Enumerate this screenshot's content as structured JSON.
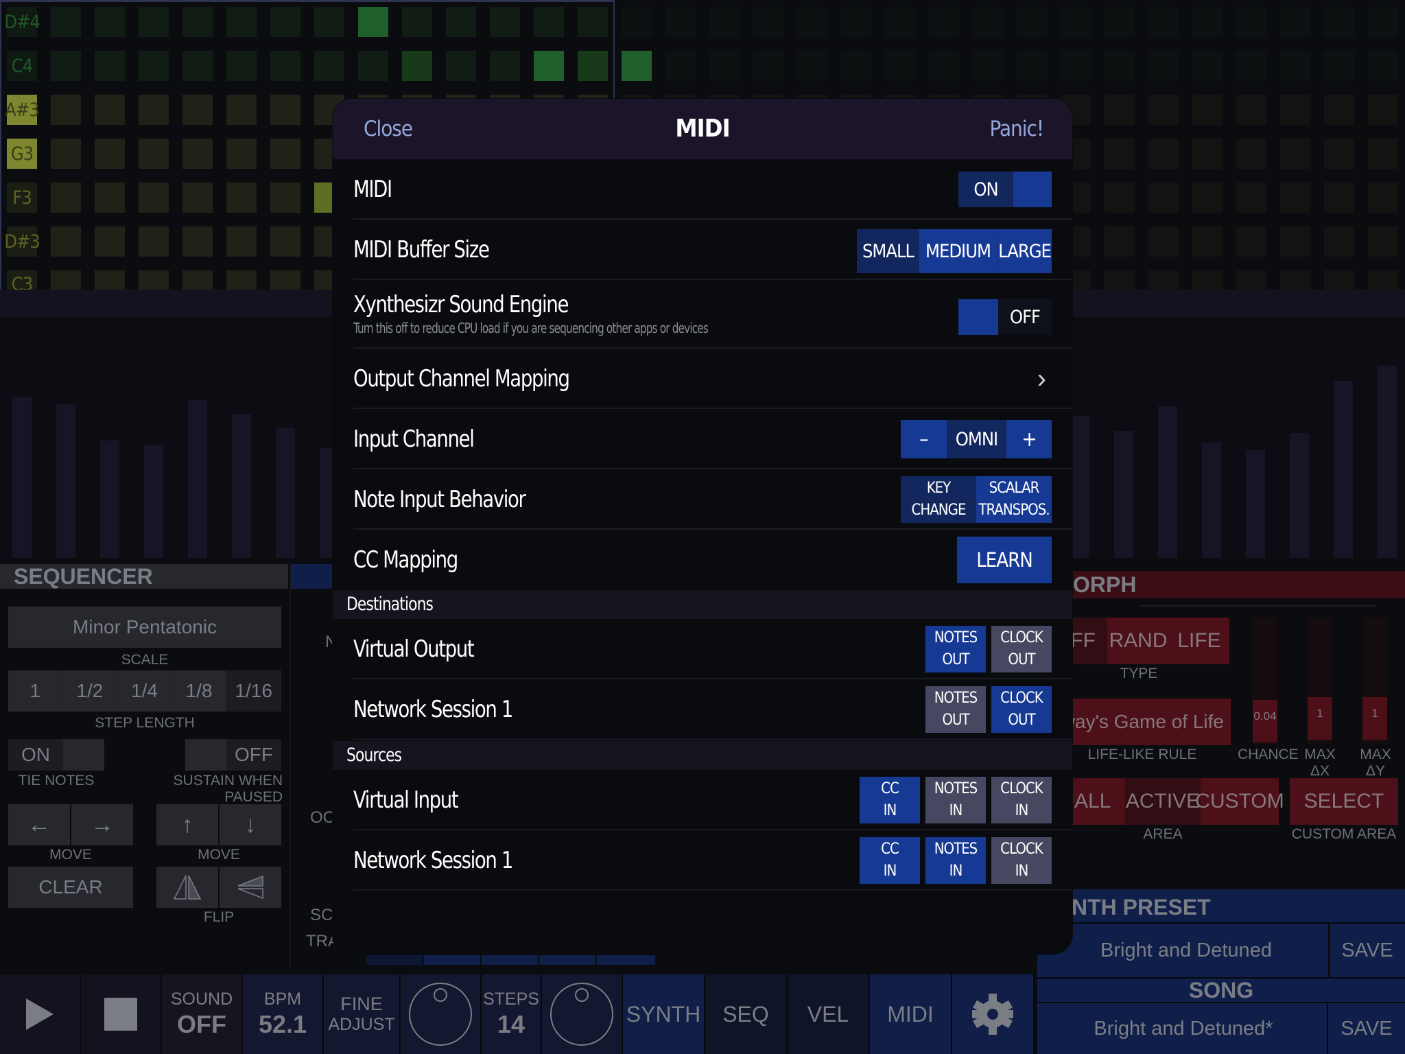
{
  "modal": {
    "title": "MIDI",
    "close_label": "Close",
    "panic_label": "Panic!",
    "rows": {
      "midi": {
        "label": "MIDI",
        "toggle": {
          "value": "ON",
          "state": "on"
        }
      },
      "buffer": {
        "label": "MIDI Buffer Size",
        "options": [
          "SMALL",
          "MEDIUM",
          "LARGE"
        ],
        "selected": "SMALL"
      },
      "engine": {
        "label": "Xynthesizr Sound Engine",
        "sublabel": "Turn this off to reduce CPU load if you are sequencing other apps or devices",
        "toggle": {
          "value": "OFF",
          "state": "off"
        }
      },
      "output_mapping": {
        "label": "Output Channel Mapping",
        "chevron": "chevron-right-icon"
      },
      "input_channel": {
        "label": "Input Channel",
        "minus": "–",
        "value": "OMNI",
        "plus": "+"
      },
      "note_input": {
        "label": "Note Input Behavior",
        "options": [
          {
            "line1": "KEY",
            "line2": "CHANGE"
          },
          {
            "line1": "SCALAR",
            "line2": "TRANSPOS."
          }
        ],
        "selected": "KEY CHANGE"
      },
      "cc_mapping": {
        "label": "CC Mapping",
        "button": "LEARN"
      }
    },
    "destinations": {
      "header": "Destinations",
      "items": [
        {
          "name": "Virtual Output",
          "buttons": [
            {
              "l1": "NOTES",
              "l2": "OUT",
              "on": true
            },
            {
              "l1": "CLOCK",
              "l2": "OUT",
              "on": false
            }
          ]
        },
        {
          "name": "Network Session 1",
          "buttons": [
            {
              "l1": "NOTES",
              "l2": "OUT",
              "on": false
            },
            {
              "l1": "CLOCK",
              "l2": "OUT",
              "on": true
            }
          ]
        }
      ]
    },
    "sources": {
      "header": "Sources",
      "items": [
        {
          "name": "Virtual Input",
          "buttons": [
            {
              "l1": "CC",
              "l2": "IN",
              "on": true
            },
            {
              "l1": "NOTES",
              "l2": "IN",
              "on": false
            },
            {
              "l1": "CLOCK",
              "l2": "IN",
              "on": false
            }
          ]
        },
        {
          "name": "Network Session 1",
          "buttons": [
            {
              "l1": "CC",
              "l2": "IN",
              "on": true
            },
            {
              "l1": "NOTES",
              "l2": "IN",
              "on": true
            },
            {
              "l1": "CLOCK",
              "l2": "IN",
              "on": false
            }
          ]
        }
      ]
    }
  },
  "grid": {
    "notes": [
      "D#4",
      "C4",
      "A#3",
      "G3",
      "F3",
      "D#3",
      "C3"
    ],
    "highlighted_notes": [
      "A#3",
      "G3"
    ],
    "active_steps": [
      {
        "note": "D#4",
        "step": 8,
        "level": "bright"
      },
      {
        "note": "C4",
        "step": 9,
        "level": "medium"
      },
      {
        "note": "C4",
        "step": 12,
        "level": "bright"
      },
      {
        "note": "C4",
        "step": 13,
        "level": "medium"
      },
      {
        "note": "C4",
        "step": 14,
        "level": "bright"
      },
      {
        "note": "F3",
        "step": 7,
        "level": "bright"
      }
    ]
  },
  "velocity": {
    "left": [
      0.84,
      0.8,
      0.61,
      0.59,
      0.82,
      0.75,
      0.68,
      0.57
    ],
    "right": [
      0.74,
      0.66,
      0.79,
      0.6,
      0.56,
      0.65,
      0.92,
      1.0
    ]
  },
  "sequencer": {
    "title": "SEQUENCER",
    "scale": {
      "value": "Minor Pentatonic",
      "caption": "SCALE"
    },
    "step_length": {
      "options": [
        "1",
        "1/2",
        "1/4",
        "1/8",
        "1/16"
      ],
      "selected": "1/16",
      "caption": "STEP LENGTH"
    },
    "tie_notes": {
      "value": "ON",
      "caption": "TIE NOTES"
    },
    "sustain": {
      "value": "OFF",
      "caption": "SUSTAIN WHEN PAUSED"
    },
    "move_h": {
      "caption": "MOVE",
      "left": "←",
      "right": "→"
    },
    "move_v": {
      "caption": "MOVE",
      "up": "↑",
      "down": "↓"
    },
    "clear_label": "CLEAR",
    "flip_caption": "FLIP"
  },
  "mid_column": {
    "partial_labels": [
      "N",
      "OCT",
      "SCA",
      "TRA"
    ]
  },
  "morph": {
    "title": "ORPH",
    "type": {
      "options": [
        "OFF",
        "RAND",
        "LIFE"
      ],
      "selected": "OFF",
      "caption": "TYPE"
    },
    "rule": {
      "value": "Conway's Game of Life",
      "caption": "LIFE-LIKE RULE"
    },
    "chance": {
      "value": "0.04",
      "caption": "CHANCE"
    },
    "max_dx": {
      "value": "1",
      "caption": "MAX ΔX"
    },
    "max_dy": {
      "value": "1",
      "caption": "MAX ΔY"
    },
    "area": {
      "options": [
        "ALL",
        "ACTIVE",
        "CUSTOM"
      ],
      "selected": "ACTIVE",
      "caption": "AREA"
    },
    "custom_area": {
      "button": "SELECT",
      "caption": "CUSTOM AREA"
    }
  },
  "presets": {
    "synth_title": "NTH PRESET",
    "synth_value": "Bright and Detuned",
    "synth_save": "SAVE",
    "song_title": "SONG",
    "song_value": "Bright and Detuned*",
    "song_save": "SAVE"
  },
  "bottom_bar": {
    "sound": {
      "label": "SOUND",
      "value": "OFF"
    },
    "bpm": {
      "label": "BPM",
      "value": "52.1"
    },
    "fine": {
      "line1": "FINE",
      "line2": "ADJUST"
    },
    "steps": {
      "label": "STEPS",
      "value": "14"
    },
    "tabs": [
      "SYNTH",
      "SEQ",
      "VEL",
      "MIDI"
    ]
  },
  "colors": {
    "accent_on": "#163994",
    "accent_off": "#12275e",
    "toggle_gray": "#464760",
    "header_bg": "#1c1529",
    "link": "#95a7dd",
    "morph_red": "#4d1018"
  }
}
